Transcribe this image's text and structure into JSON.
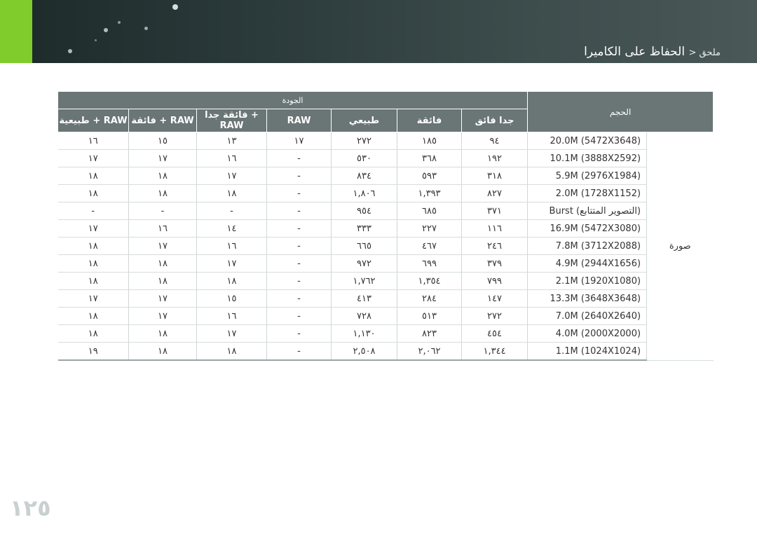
{
  "header": {
    "section": "الحفاظ على الكاميرا",
    "crumb": "ملحق <",
    "accent_color": "#7fcc2c"
  },
  "table": {
    "group_header": "الجودة",
    "size_header": "الحجم",
    "quality_columns": [
      "جدا فائق",
      "فائقة",
      "طبيعي",
      "RAW",
      "فائقة جدا + RAW",
      "فائقة + RAW",
      "طبيعية + RAW"
    ],
    "mode_label": "صورة",
    "rows": [
      {
        "size": "20.0M (5472X3648)",
        "q": [
          "٩٤",
          "١٨٥",
          "٢٧٢",
          "١٧",
          "١٣",
          "١٥",
          "١٦"
        ]
      },
      {
        "size": "10.1M (3888X2592)",
        "q": [
          "١٩٢",
          "٣٦٨",
          "٥٣٠",
          "-",
          "١٦",
          "١٧",
          "١٧"
        ]
      },
      {
        "size": "5.9M (2976X1984)",
        "q": [
          "٣١٨",
          "٥٩٣",
          "٨٣٤",
          "-",
          "١٧",
          "١٨",
          "١٨"
        ]
      },
      {
        "size": "2.0M (1728X1152)",
        "q": [
          "٨٢٧",
          "١,٣٩٣",
          "١,٨٠٦",
          "-",
          "١٨",
          "١٨",
          "١٨"
        ]
      },
      {
        "size": "Burst (التصوير المتتابع)",
        "q": [
          "٣٧١",
          "٦٨٥",
          "٩٥٤",
          "-",
          "-",
          "-",
          "-"
        ]
      },
      {
        "size": "16.9M (5472X3080)",
        "q": [
          "١١٦",
          "٢٢٧",
          "٣٣٣",
          "-",
          "١٤",
          "١٦",
          "١٧"
        ]
      },
      {
        "size": "7.8M (3712X2088)",
        "q": [
          "٢٤٦",
          "٤٦٧",
          "٦٦٥",
          "-",
          "١٦",
          "١٧",
          "١٨"
        ]
      },
      {
        "size": "4.9M (2944X1656)",
        "q": [
          "٣٧٩",
          "٦٩٩",
          "٩٧٢",
          "-",
          "١٧",
          "١٨",
          "١٨"
        ]
      },
      {
        "size": "2.1M (1920X1080)",
        "q": [
          "٧٩٩",
          "١,٣٥٤",
          "١,٧٦٢",
          "-",
          "١٨",
          "١٨",
          "١٨"
        ]
      },
      {
        "size": "13.3M (3648X3648)",
        "q": [
          "١٤٧",
          "٢٨٤",
          "٤١٣",
          "-",
          "١٥",
          "١٧",
          "١٧"
        ]
      },
      {
        "size": "7.0M (2640X2640)",
        "q": [
          "٢٧٢",
          "٥١٣",
          "٧٢٨",
          "-",
          "١٦",
          "١٧",
          "١٨"
        ]
      },
      {
        "size": "4.0M (2000X2000)",
        "q": [
          "٤٥٤",
          "٨٢٣",
          "١,١٣٠",
          "-",
          "١٧",
          "١٨",
          "١٨"
        ]
      },
      {
        "size": "1.1M (1024X1024)",
        "q": [
          "١,٣٤٤",
          "٢,٠٦٢",
          "٢,٥٠٨",
          "-",
          "١٨",
          "١٨",
          "١٩"
        ]
      }
    ]
  },
  "page_number": "١٢٥"
}
